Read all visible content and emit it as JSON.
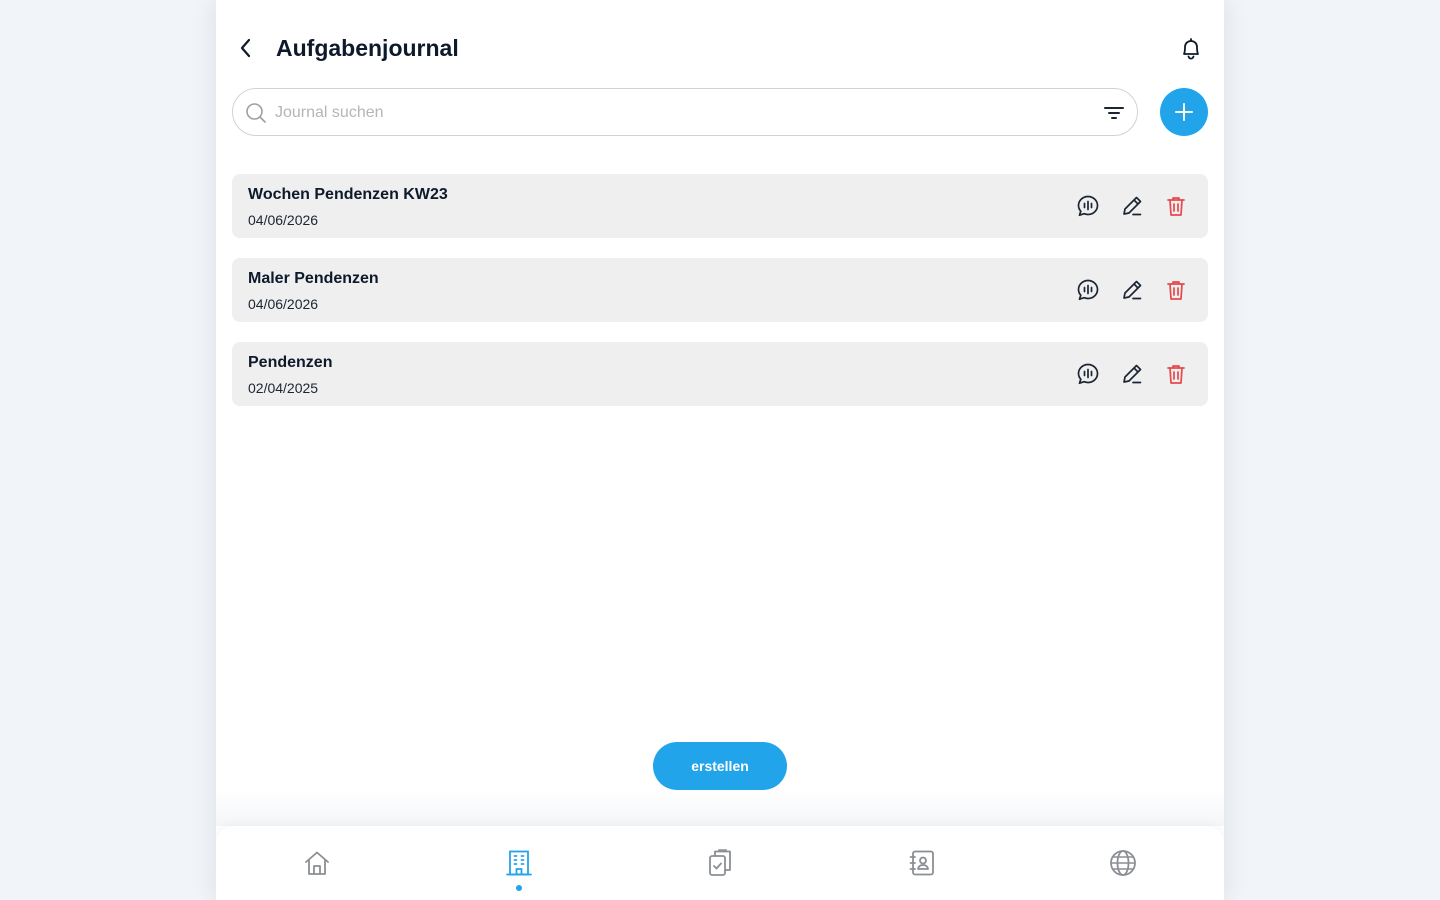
{
  "header": {
    "title": "Aufgabenjournal",
    "back_icon": "chevron-left-icon",
    "bell_icon": "bell-icon"
  },
  "search": {
    "placeholder": "Journal suchen",
    "value": "",
    "search_icon": "search-icon",
    "filter_icon": "filter-icon"
  },
  "add_button": {
    "icon": "plus-icon"
  },
  "journals": [
    {
      "title": "Wochen Pendenzen KW23",
      "date": "04/06/2026"
    },
    {
      "title": "Maler Pendenzen",
      "date": "04/06/2026"
    },
    {
      "title": "Pendenzen",
      "date": "02/04/2025"
    }
  ],
  "create_button": {
    "label": "erstellen"
  },
  "bottom_nav": {
    "items": [
      {
        "name": "home",
        "icon": "home-icon",
        "active": false
      },
      {
        "name": "buildings",
        "icon": "building-icon",
        "active": true
      },
      {
        "name": "tasks",
        "icon": "clipboard-check-icon",
        "active": false
      },
      {
        "name": "contacts",
        "icon": "contact-book-icon",
        "active": false
      },
      {
        "name": "web",
        "icon": "globe-icon",
        "active": false
      }
    ]
  },
  "colors": {
    "accent": "#22a4ea",
    "text": "#0e1a2b",
    "danger": "#e5484d",
    "item_bg": "#efefef",
    "inactive_icon": "#8b8f94"
  }
}
